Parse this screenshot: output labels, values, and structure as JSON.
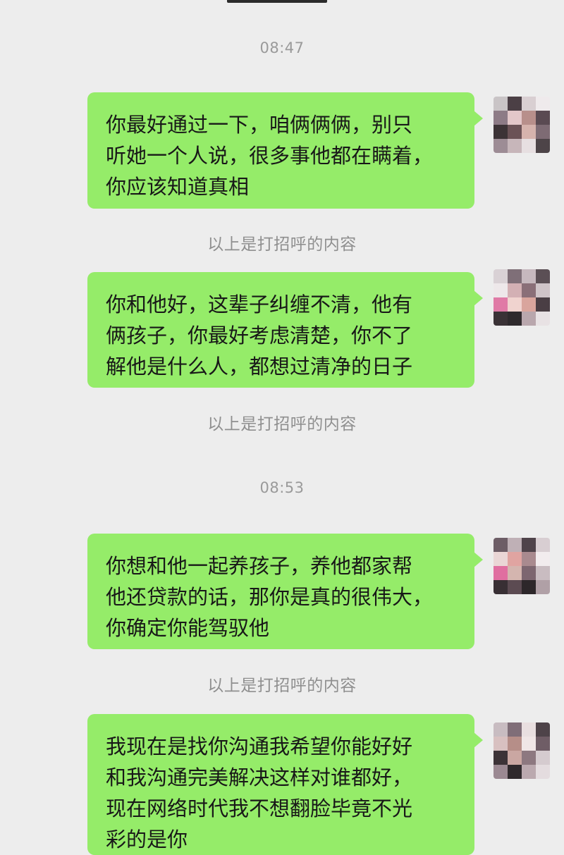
{
  "chat": {
    "timestamps": [
      "08:47",
      "08:53"
    ],
    "notice_text": "以上是打招呼的内容",
    "messages": [
      {
        "text": "你最好通过一下，咱俩俩俩，别只\n听她一个人说，很多事他都在瞒着，\n你应该知道真相"
      },
      {
        "text": "你和他好，这辈子纠缠不清，他有\n俩孩子，你最好考虑清楚，你不了\n解他是什么人，都想过清净的日子"
      },
      {
        "text": "你想和他一起养孩子，养他都家帮\n他还贷款的话，那你是真的很伟大，\n你确定你能驾驭他"
      },
      {
        "text": "我现在是找你沟通我希望你能好好\n和我沟通完美解决这样对谁都好，\n现在网络时代我不想翻脸毕竟不光\n彩的是你"
      }
    ]
  },
  "colors": {
    "background": "#ededed",
    "bubble": "#95ec69",
    "text": "#181818",
    "meta_text": "#9a9a9a"
  },
  "avatar_icon": "pixelated-avatar-icon"
}
